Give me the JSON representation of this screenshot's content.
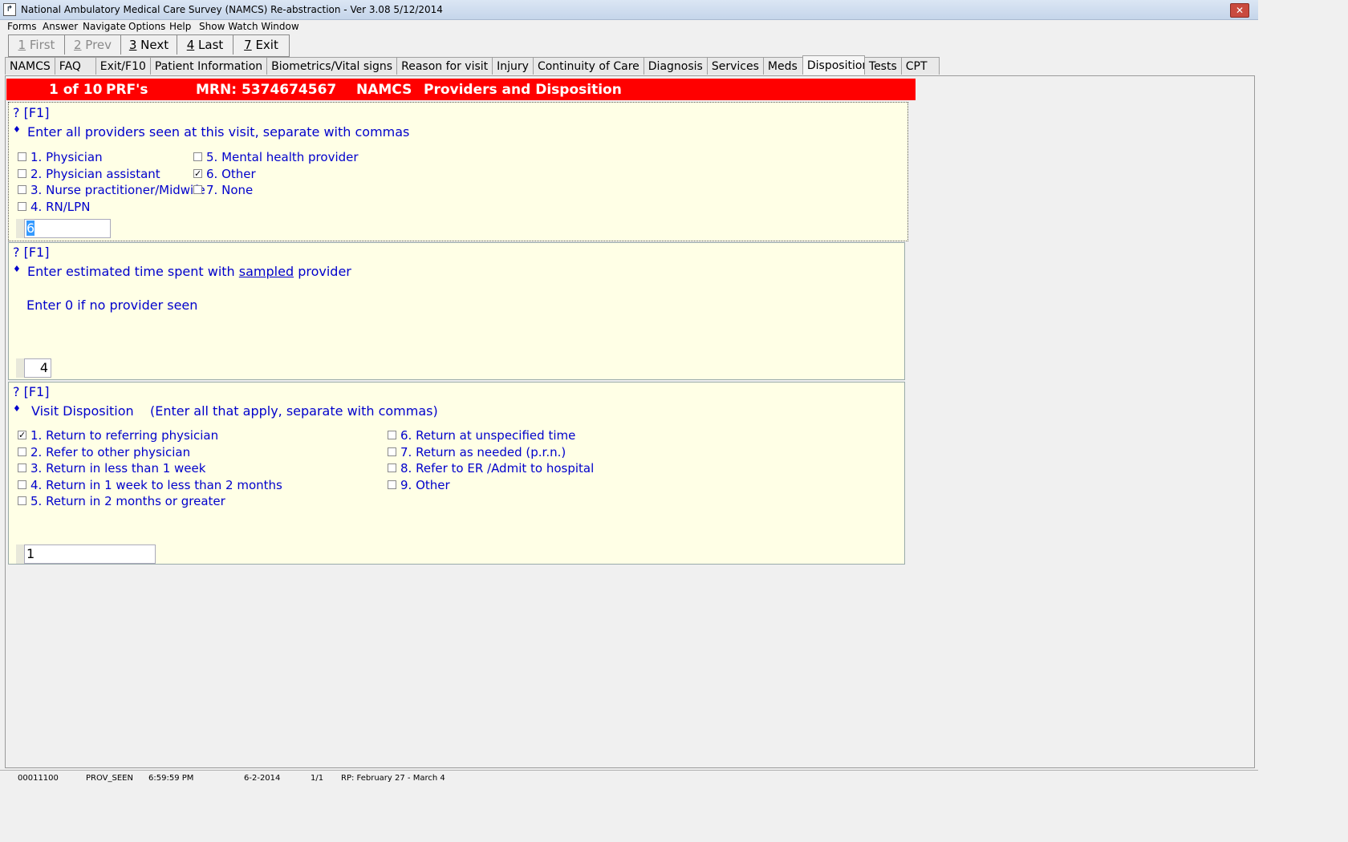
{
  "window": {
    "title": "National Ambulatory Medical Care Survey (NAMCS) Re-abstraction  - Ver 3.08 5/12/2014",
    "close_glyph": "✕"
  },
  "menu": [
    "Forms",
    "Answer",
    "Navigate",
    "Options",
    "Help",
    "Show Watch Window"
  ],
  "nav": [
    {
      "key": "1",
      "label": " First",
      "enabled": false
    },
    {
      "key": "2",
      "label": " Prev",
      "enabled": false
    },
    {
      "key": "3",
      "label": " Next",
      "enabled": true
    },
    {
      "key": "4",
      "label": " Last",
      "enabled": true
    },
    {
      "key": "7",
      "label": " Exit",
      "enabled": true
    }
  ],
  "tabs": [
    "NAMCS",
    "FAQ",
    "Exit/F10",
    "Patient Information",
    "Biometrics/Vital signs",
    "Reason for visit",
    "Injury",
    "Continuity of Care",
    "Diagnosis",
    "Services",
    "Meds",
    "Disposition",
    "Tests",
    "CPT"
  ],
  "active_tab": "Disposition",
  "header": {
    "record": "1 of 10",
    "form": "PRF's",
    "mrn": "MRN: 5374674567",
    "survey": "NAMCS",
    "section": "Providers and Disposition",
    "color": "#ff0000"
  },
  "q1": {
    "help": "? [F1]",
    "bullet": "♦",
    "prompt": "Enter all providers seen at this visit, separate with commas",
    "options": [
      {
        "num": "1.",
        "label": "Physician",
        "checked": false
      },
      {
        "num": "2.",
        "label": "Physician assistant",
        "checked": false
      },
      {
        "num": "3.",
        "label": "Nurse practitioner/Midwife",
        "checked": false
      },
      {
        "num": "4.",
        "label": "RN/LPN",
        "checked": false
      },
      {
        "num": "5.",
        "label": "Mental health provider",
        "checked": false
      },
      {
        "num": "6.",
        "label": "Other",
        "checked": true
      },
      {
        "num": "7.",
        "label": "None",
        "checked": false
      }
    ],
    "value": "6"
  },
  "q2": {
    "help": "? [F1]",
    "bullet": "♦",
    "prompt_before": "Enter estimated time spent with ",
    "prompt_underlined": "sampled",
    "prompt_after": " provider",
    "note": "Enter 0 if no provider seen",
    "value": "4"
  },
  "q3": {
    "help": "? [F1]",
    "bullet": "♦",
    "prompt": "Visit Disposition    (Enter all that apply, separate with commas)",
    "options": [
      {
        "num": "1.",
        "label": "Return to referring physician",
        "checked": true
      },
      {
        "num": "2.",
        "label": "Refer to other physician",
        "checked": false
      },
      {
        "num": "3.",
        "label": "Return in less than 1 week",
        "checked": false
      },
      {
        "num": "4.",
        "label": "Return in 1 week to less than 2 months",
        "checked": false
      },
      {
        "num": "5.",
        "label": "Return in 2 months or greater",
        "checked": false
      },
      {
        "num": "6.",
        "label": "Return at unspecified time",
        "checked": false
      },
      {
        "num": "7.",
        "label": "Return as needed (p.r.n.)",
        "checked": false
      },
      {
        "num": "8.",
        "label": "Refer to ER /Admit to hospital",
        "checked": false
      },
      {
        "num": "9.",
        "label": "Other",
        "checked": false
      }
    ],
    "value": "1"
  },
  "status": {
    "id": "00011100",
    "field": "PROV_SEEN",
    "time": "6:59:59 PM",
    "date": "6-2-2014",
    "page": "1/1",
    "rp": "RP: February 27 - March 4"
  },
  "check_glyph": "✓"
}
